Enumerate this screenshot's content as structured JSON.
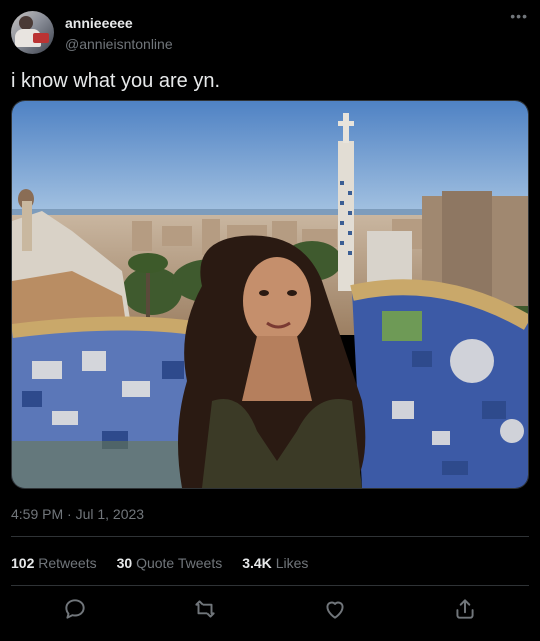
{
  "author": {
    "display_name": "annieeeee",
    "handle": "@annieisntonline"
  },
  "tweet": {
    "text": "i know what you are yn.",
    "timestamp": "4:59 PM · Jul 1, 2023"
  },
  "stats": {
    "retweets_count": "102",
    "retweets_label": "Retweets",
    "quotes_count": "30",
    "quotes_label": "Quote Tweets",
    "likes_count": "3.4K",
    "likes_label": "Likes"
  },
  "icons": {
    "more": "more-icon",
    "reply": "reply-icon",
    "retweet": "retweet-icon",
    "like": "heart-icon",
    "share": "share-icon"
  },
  "colors": {
    "background": "#000000",
    "primary_text": "#e7e9ea",
    "secondary_text": "#71767b",
    "divider": "#2f3336"
  }
}
